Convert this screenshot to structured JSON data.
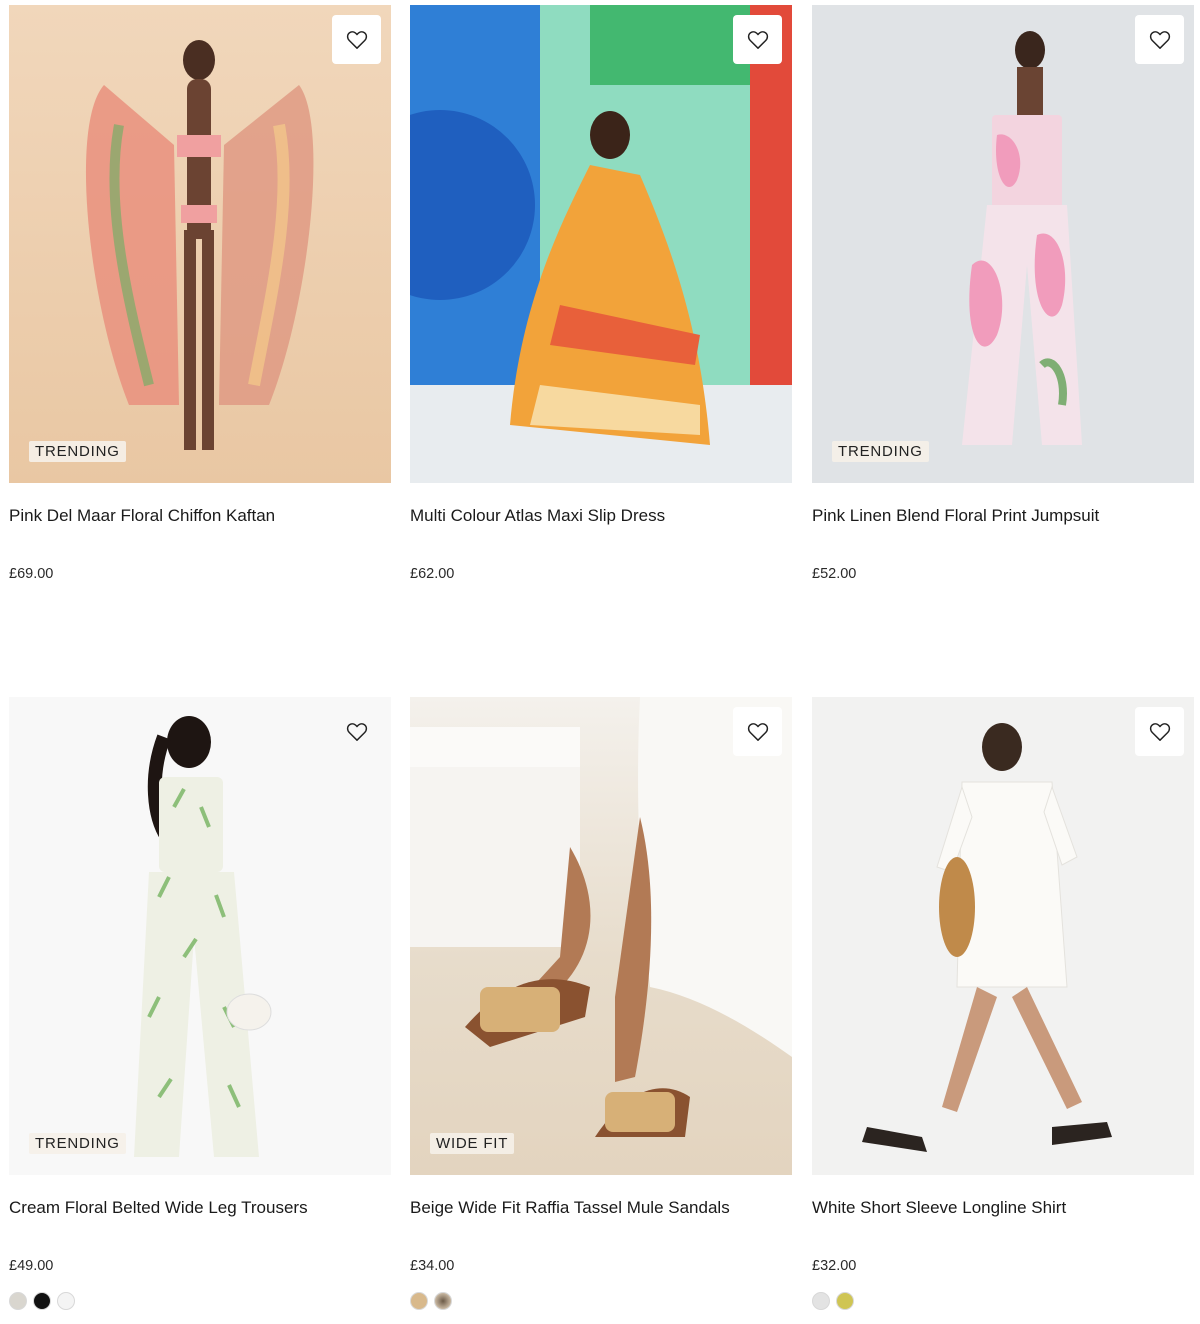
{
  "products": [
    {
      "name": "Pink Del Maar Floral Chiffon Kaftan",
      "price": "£69.00",
      "badge": "TRENDING",
      "image_bg": "#eed2b4",
      "garment_colors": [
        "#e88a7a",
        "#7fb36a",
        "#f1c88a"
      ],
      "swatches": []
    },
    {
      "name": "Multi Colour Atlas Maxi Slip Dress",
      "price": "£62.00",
      "badge": "",
      "image_bg": "#7ad3b0",
      "garment_colors": [
        "#f0a030",
        "#e8603a",
        "#f6d9a0"
      ],
      "swatches": []
    },
    {
      "name": "Pink Linen Blend Floral Print Jumpsuit",
      "price": "£52.00",
      "badge": "TRENDING",
      "image_bg": "#dfe2e5",
      "garment_colors": [
        "#f0a8c0",
        "#f6e4ea",
        "#7fae74"
      ],
      "swatches": []
    },
    {
      "name": "Cream Floral Belted Wide Leg Trousers",
      "price": "£49.00",
      "badge": "TRENDING",
      "image_bg": "#f7f7f7",
      "garment_colors": [
        "#eef0e4",
        "#8dbf7a",
        "#e9e4d6"
      ],
      "swatches": [
        "#d9d6cf",
        "#111111",
        "#f4f4f4"
      ]
    },
    {
      "name": "Beige Wide Fit Raffia Tassel Mule Sandals",
      "price": "£34.00",
      "badge": "WIDE FIT",
      "image_bg": "#e9ddcd",
      "garment_colors": [
        "#c89b62",
        "#8a5230",
        "#f8f6f2"
      ],
      "swatches": [
        "#d8b98c",
        "#a08f7c"
      ]
    },
    {
      "name": "White Short Sleeve Longline Shirt",
      "price": "£32.00",
      "badge": "",
      "image_bg": "#f1f1f0",
      "garment_colors": [
        "#f7f6f3",
        "#c08a4a",
        "#3a2a20"
      ],
      "swatches": [
        "#e3e3e3",
        "#cfc554"
      ]
    }
  ],
  "wishlist_icon": "heart-outline-icon"
}
